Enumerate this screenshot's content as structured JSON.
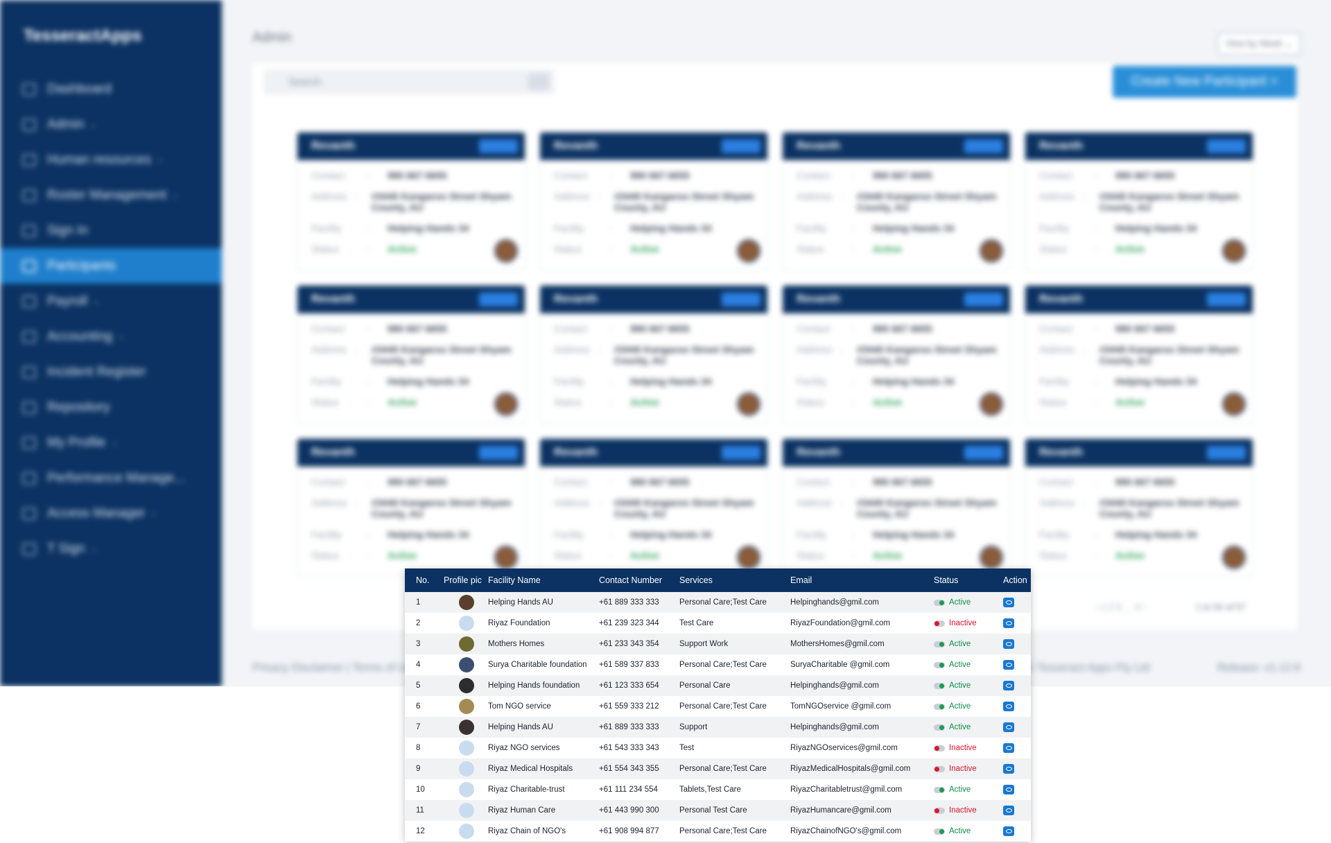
{
  "app": {
    "brand": "TesseractApps",
    "page_title": "Admin",
    "view_dropdown": "View by Week ⌄",
    "search_placeholder": "Search",
    "create_button": "Create New Participant +",
    "pager": "‹ 1 2 3 … 4 ›",
    "pager_count": "1 to 50 of 57",
    "footer_left": "Privacy Disclaimer | Terms of Use",
    "footer_mid": "© Tesseract Apps Pty Ltd",
    "footer_right": "Release: v1.12.8"
  },
  "sidebar": {
    "items": [
      {
        "label": "Dashboard",
        "chev": ""
      },
      {
        "label": "Admin",
        "chev": "›"
      },
      {
        "label": "Human resources",
        "chev": "›"
      },
      {
        "label": "Roster Management",
        "chev": "›"
      },
      {
        "label": "Sign In",
        "chev": ""
      },
      {
        "label": "Participants",
        "chev": ""
      },
      {
        "label": "Payroll",
        "chev": "›"
      },
      {
        "label": "Accounting",
        "chev": "›"
      },
      {
        "label": "Incident Register",
        "chev": ""
      },
      {
        "label": "Repository",
        "chev": ""
      },
      {
        "label": "My Profile",
        "chev": "›"
      },
      {
        "label": "Performance Manage...",
        "chev": ""
      },
      {
        "label": "Access Manager",
        "chev": "›"
      },
      {
        "label": "T Sign",
        "chev": "›"
      }
    ]
  },
  "card": {
    "name": "Revanth",
    "contact_label": "Contact",
    "contact": "990 667 6655",
    "address_label": "Address",
    "address": "#3440 Kangaroo Street Shyam County, AU",
    "facility_label": "Facility",
    "facility": "Helping Hands 34",
    "status_label": "Status",
    "status": "Active",
    "colon": ":"
  },
  "table": {
    "headers": [
      "No.",
      "Profile pic",
      "Facility Name",
      "Contact Number",
      "Services",
      "Email",
      "Status",
      "Action"
    ],
    "rows": [
      {
        "no": "1",
        "name": "Helping Hands AU",
        "contact": "+61 889 333 333",
        "services": "Personal Care;Test Care",
        "email": "Helpinghands@gmil.com",
        "status": "Active",
        "avatar_color": "#5a3f2e"
      },
      {
        "no": "2",
        "name": "Riyaz Foundation",
        "contact": "+61 239 323 344",
        "services": "Test Care",
        "email": "RiyazFoundation@gmil.com",
        "status": "Inactive",
        "avatar_color": "#c9dcef"
      },
      {
        "no": "3",
        "name": "Mothers Homes",
        "contact": "+61 233 343 354",
        "services": "Support Work",
        "email": "MothersHomes@gmil.com",
        "status": "Active",
        "avatar_color": "#6f6a32"
      },
      {
        "no": "4",
        "name": "Surya Charitable foundation",
        "contact": "+61 589 337 833",
        "services": "Personal Care;Test Care",
        "email": "SuryaCharitable @gmil.com",
        "status": "Active",
        "avatar_color": "#3a4f72"
      },
      {
        "no": "5",
        "name": "Helping Hands foundation",
        "contact": "+61 123 333 654",
        "services": "Personal Care",
        "email": "Helpinghands@gmil.com",
        "status": "Active",
        "avatar_color": "#2f2c30"
      },
      {
        "no": "6",
        "name": "Tom NGO service",
        "contact": "+61 559 333 212",
        "services": "Personal Care;Test Care",
        "email": "TomNGOservice @gmil.com",
        "status": "Active",
        "avatar_color": "#a58a54"
      },
      {
        "no": "7",
        "name": "Helping Hands AU",
        "contact": "+61 889 333 333",
        "services": "Support",
        "email": "Helpinghands@gmil.com",
        "status": "Active",
        "avatar_color": "#3b3130"
      },
      {
        "no": "8",
        "name": "Riyaz NGO services",
        "contact": "+61 543 333 343",
        "services": "Test",
        "email": "RiyazNGOservices@gmil.com",
        "status": "Inactive",
        "avatar_color": "#c9dcef"
      },
      {
        "no": "9",
        "name": "Riyaz Medical Hospitals",
        "contact": "+61 554 343 355",
        "services": "Personal Care;Test Care",
        "email": "RiyazMedicalHospitals@gmil.com",
        "status": "Inactive",
        "avatar_color": "#c9dcef"
      },
      {
        "no": "10",
        "name": "Riyaz Charitable-trust",
        "contact": "+61 111 234 554",
        "services": "Tablets,Test Care",
        "email": "RiyazCharitabletrust@gmil.com",
        "status": "Active",
        "avatar_color": "#c9dcef"
      },
      {
        "no": "11",
        "name": "Riyaz Human Care",
        "contact": "+61 443 990 300",
        "services": "Personal Test Care",
        "email": "RiyazHumancare@gmil.com",
        "status": "Inactive",
        "avatar_color": "#c9dcef"
      },
      {
        "no": "12",
        "name": "Riyaz Chain of NGO's",
        "contact": "+61 908 994 877",
        "services": "Personal Care;Test Care",
        "email": "RiyazChainofNGO's@gmil.com",
        "status": "Active",
        "avatar_color": "#c9dcef"
      }
    ]
  },
  "colors": {
    "navy": "#0b3262",
    "accent": "#1f7fcc",
    "active": "#0f8e45",
    "inactive": "#d9122c"
  }
}
